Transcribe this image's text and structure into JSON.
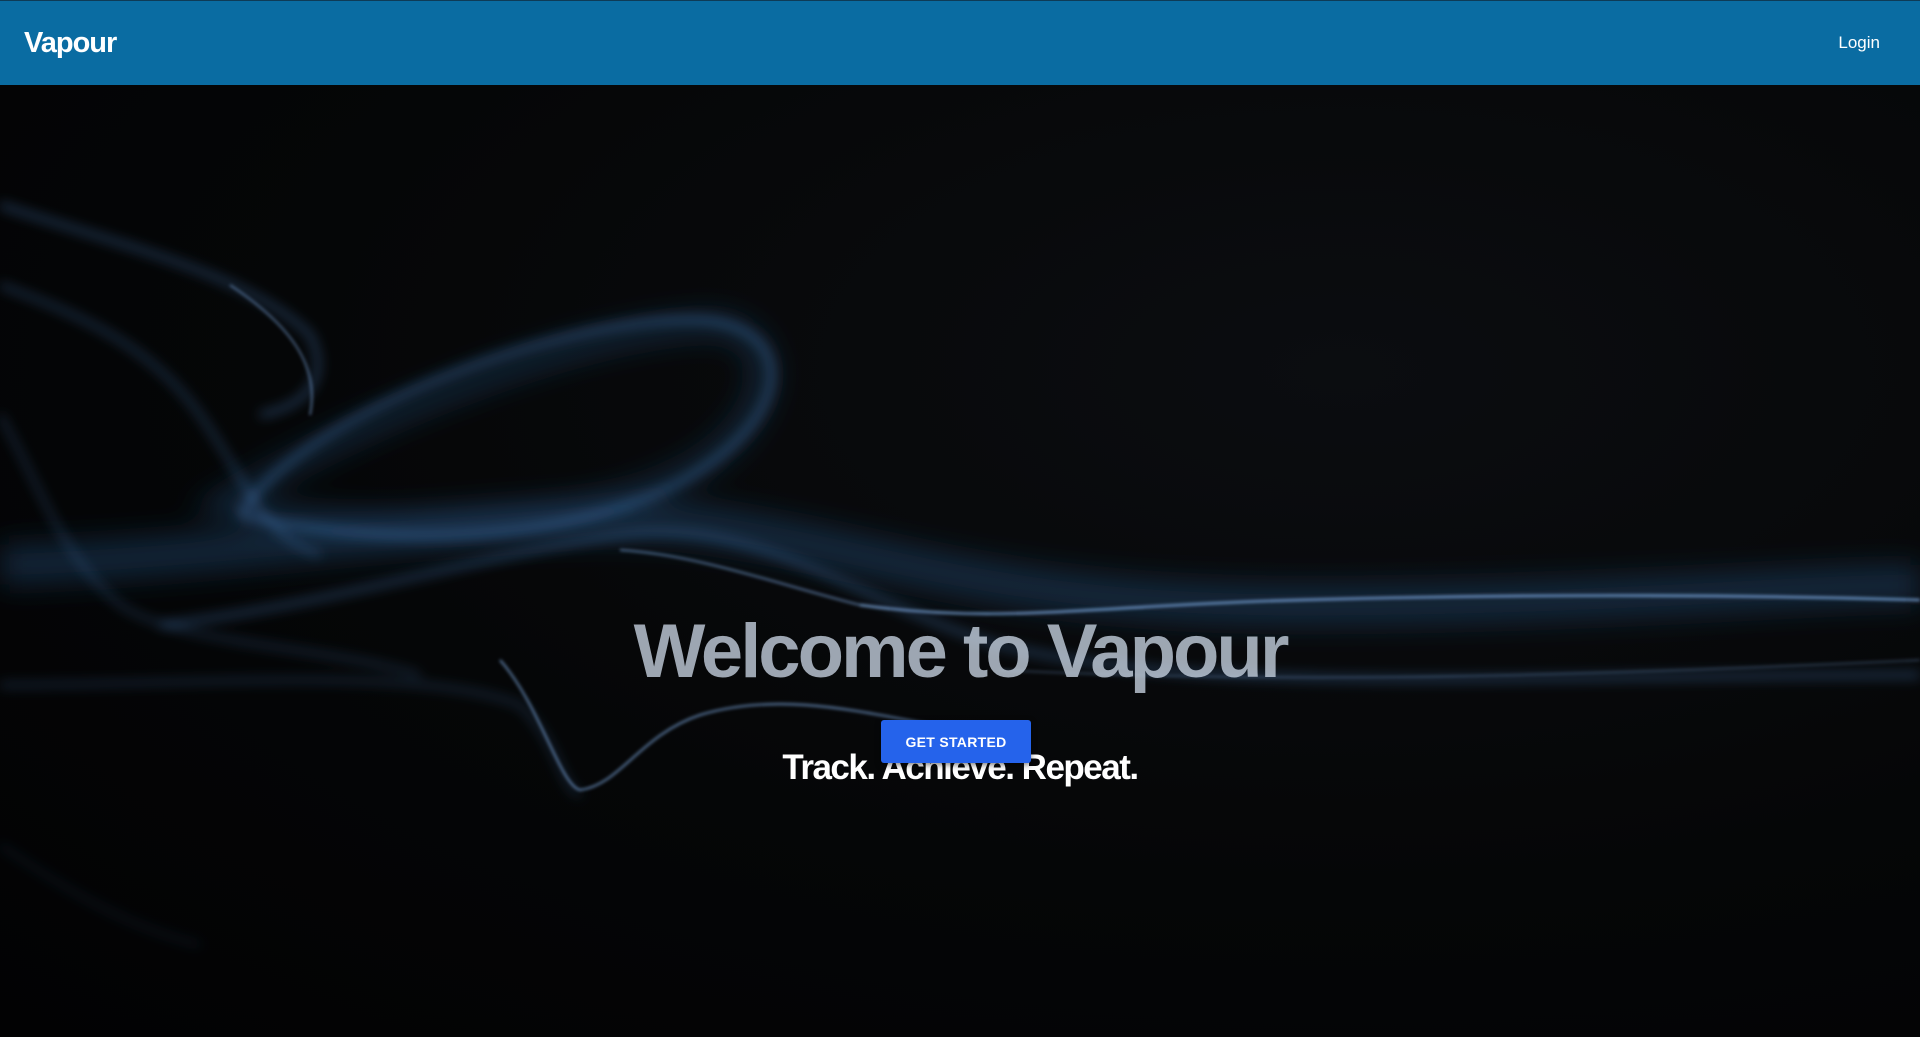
{
  "navbar": {
    "brand": "Vapour",
    "login_label": "Login"
  },
  "hero": {
    "title": "Welcome to Vapour",
    "tagline": "Track. Achieve. Repeat.",
    "cta_label": "GET STARTED"
  },
  "colors": {
    "navbar_bg": "#0a6ca2",
    "cta_bg": "#2563eb",
    "hero_bg": "#050607",
    "smoke_accent": "#4f8fd6"
  }
}
